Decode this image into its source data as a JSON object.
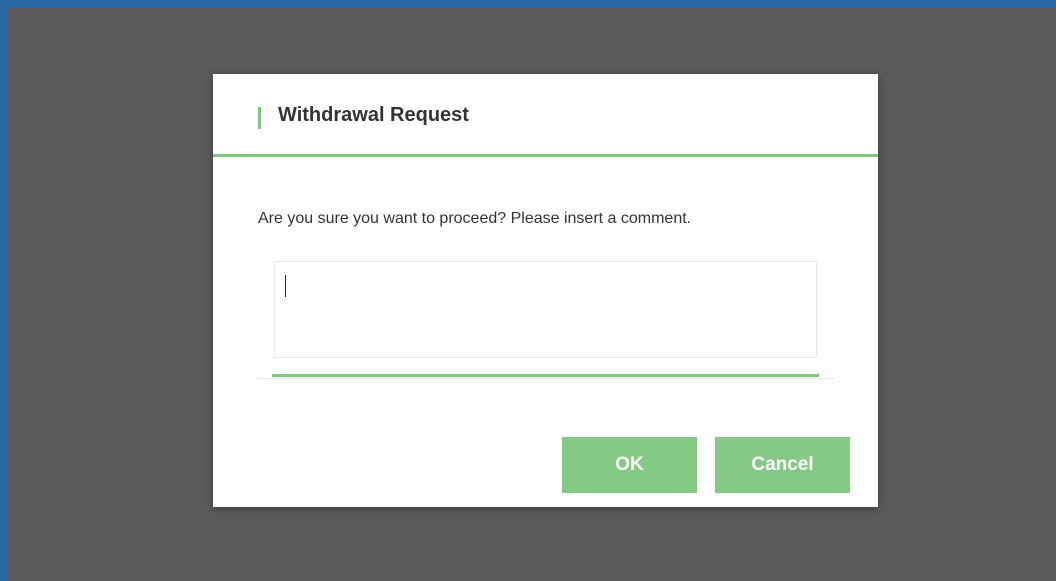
{
  "dialog": {
    "title": "Withdrawal Request",
    "message": "Are you sure you want to proceed? Please insert a comment.",
    "comment": {
      "value": "",
      "placeholder": ""
    },
    "buttons": {
      "ok_label": "OK",
      "cancel_label": "Cancel"
    }
  },
  "colors": {
    "accent": "#7dc77f",
    "button": "#84ca85",
    "overlay": "#5a5a5a",
    "frame": "#2b67a5"
  }
}
